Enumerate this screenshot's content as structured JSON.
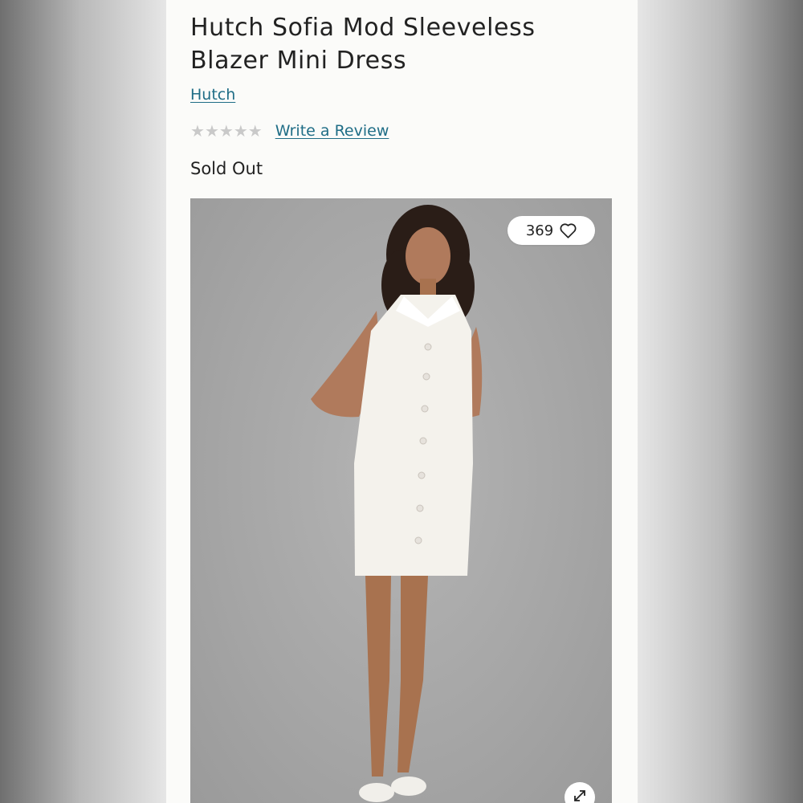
{
  "product": {
    "title": "Hutch Sofia Mod Sleeveless Blazer Mini Dress",
    "brand": "Hutch",
    "rating": {
      "stars_filled": 0,
      "stars_total": 5,
      "review_link_label": "Write a Review"
    },
    "availability": "Sold Out"
  },
  "gallery": {
    "like_count": "369",
    "like_icon": "heart-icon",
    "expand_icon": "expand-icon"
  },
  "colors": {
    "link": "#1f6d86",
    "text": "#222222",
    "star_empty": "#c9c9c9",
    "panel_bg": "#fbfbf9"
  }
}
